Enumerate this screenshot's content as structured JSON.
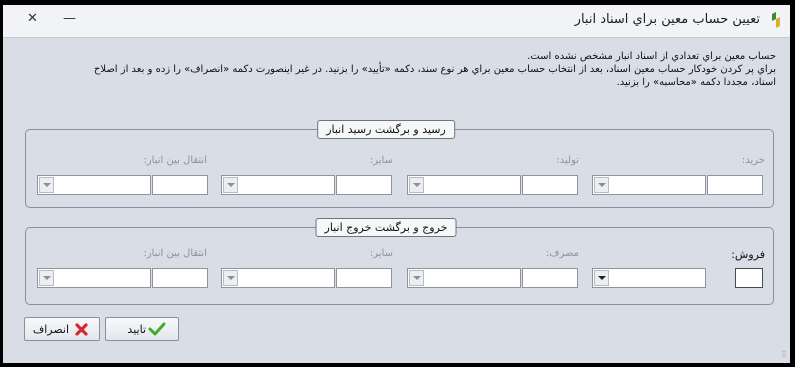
{
  "window": {
    "title": "تعيين حساب معين براي اسناد انبار",
    "close_glyph": "✕",
    "minimize_glyph": "—"
  },
  "description": {
    "line1": "حساب معين براي تعدادي از اسناد انبار مشخص نشده است.",
    "line2": "براي پر کردن خودکار حساب معين اسناد، بعد از انتخاب حساب معين براي هر نوع سند، دکمه «تأيید» را بزنيد. در غير اينصورت دکمه «انصراف» را زده و بعد از اصلاح",
    "line3": "اسناد، مجددا دکمه «محاسبه» را بزنيد."
  },
  "receipt_group": {
    "title": "رسيد و برگشت رسيد انبار",
    "fields": [
      {
        "label": "خريد:"
      },
      {
        "label": "توليد:"
      },
      {
        "label": "ساير:"
      },
      {
        "label": "انتقال بين انبار:"
      }
    ]
  },
  "issue_group": {
    "title": "خروج و برگشت خروج انبار",
    "fields": [
      {
        "label": "فروش:"
      },
      {
        "label": "مصرف:"
      },
      {
        "label": "ساير:"
      },
      {
        "label": "انتقال بين انبار:"
      }
    ]
  },
  "buttons": {
    "confirm": "تاييد",
    "cancel": "انصراف"
  },
  "colors": {
    "confirm_icon": "#3fae2a",
    "cancel_icon": "#d42a2a"
  }
}
